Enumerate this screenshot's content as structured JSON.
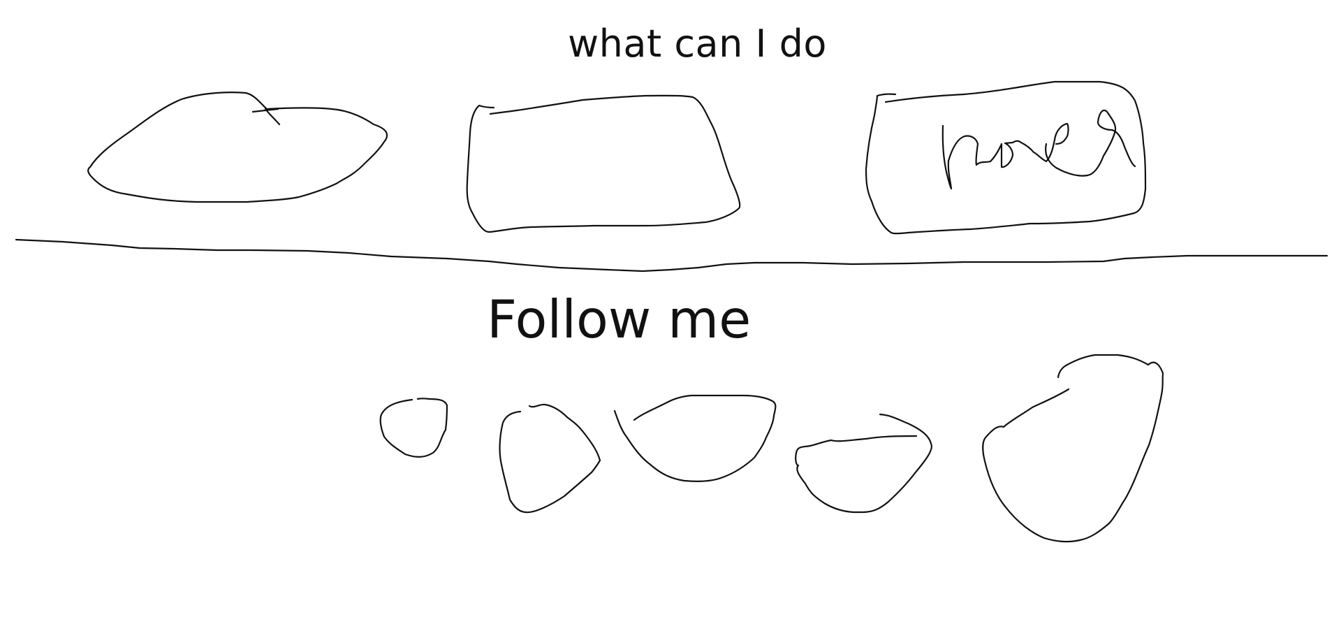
{
  "top_title": "what can I do",
  "section_title": "Follow me"
}
